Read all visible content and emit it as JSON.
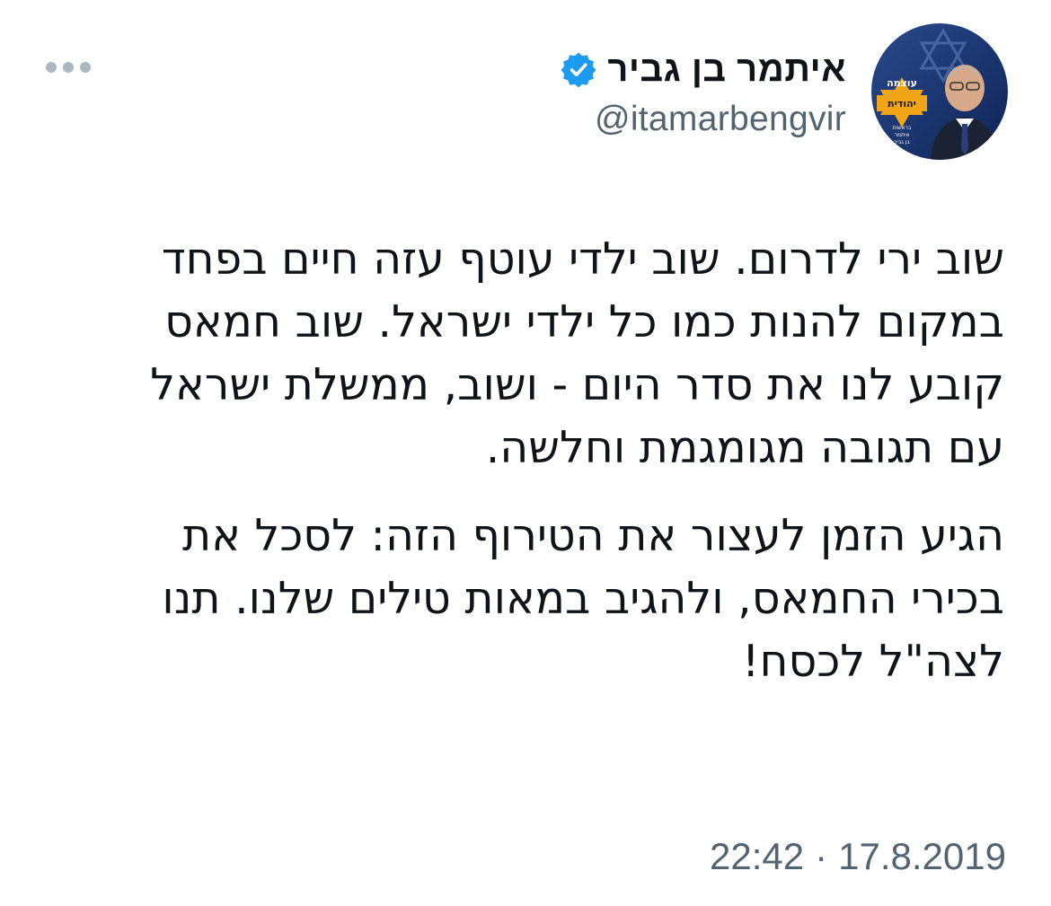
{
  "author": {
    "display_name": "איתמר בן גביר",
    "handle": "@itamarbengvir",
    "verified": true,
    "avatar_text": [
      "עוצמה",
      "יהודית",
      "בראשות",
      "איתמר",
      "בן גביר"
    ]
  },
  "menu_icon": "more-horizontal-icon",
  "tweet": {
    "paragraphs": [
      {
        "lines": [
          "שוב ירי לדרום. שוב ילדי עוטף עזה חיים בפחד",
          "במקום להנות כמו כל ילדי ישראל. שוב חמאס",
          "קובע לנו את סדר היום - ושוב, ממשלת ישראל",
          "עם תגובה מגומגמת וחלשה."
        ]
      },
      {
        "lines": [
          "הגיע הזמן לעצור את הטירוף הזה: לסכל את",
          "בכירי החמאס, ולהגיב במאות טילים שלנו. תנו",
          "לצה\"ל לכסח!"
        ]
      }
    ]
  },
  "meta": {
    "time": "22:42",
    "separator": "·",
    "date": "17.8.2019"
  },
  "colors": {
    "verified_blue": "#1d9bf0",
    "secondary_text": "#536471",
    "primary_text": "#0f1419",
    "avatar_bg": "#16306a",
    "badge_orange": "#f2a516"
  }
}
